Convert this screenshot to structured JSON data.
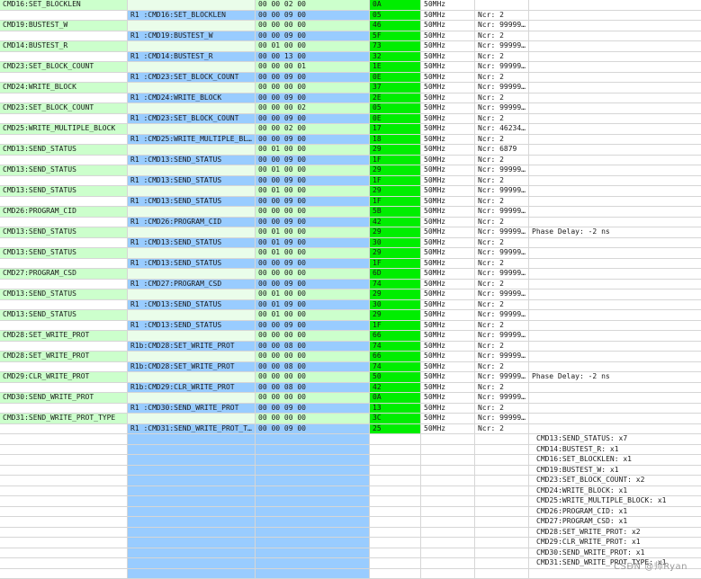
{
  "rows": [
    {
      "type": "cmd",
      "cmd": "CMD16:SET_BLOCKLEN",
      "resp": "",
      "arg": "00 00 02 00",
      "crc": "0A",
      "freq": "50MHz",
      "ncr": "",
      "note": ""
    },
    {
      "type": "resp",
      "cmd": "",
      "resp": "R1 :CMD16:SET_BLOCKLEN",
      "arg": "00 00 09 00",
      "crc": "05",
      "freq": "50MHz",
      "ncr": "Ncr: 2",
      "note": ""
    },
    {
      "type": "cmd",
      "cmd": "CMD19:BUSTEST_W",
      "resp": "",
      "arg": "00 00 00 00",
      "crc": "46",
      "freq": "50MHz",
      "ncr": "Ncr: 99999…",
      "note": ""
    },
    {
      "type": "resp",
      "cmd": "",
      "resp": "R1 :CMD19:BUSTEST_W",
      "arg": "00 00 09 00",
      "crc": "5F",
      "freq": "50MHz",
      "ncr": "Ncr: 2",
      "note": ""
    },
    {
      "type": "cmd",
      "cmd": "CMD14:BUSTEST_R",
      "resp": "",
      "arg": "00 01 00 00",
      "crc": "73",
      "freq": "50MHz",
      "ncr": "Ncr: 99999…",
      "note": ""
    },
    {
      "type": "resp",
      "cmd": "",
      "resp": "R1 :CMD14:BUSTEST_R",
      "arg": "00 00 13 00",
      "crc": "32",
      "freq": "50MHz",
      "ncr": "Ncr: 2",
      "note": ""
    },
    {
      "type": "cmd",
      "cmd": "CMD23:SET_BLOCK_COUNT",
      "resp": "",
      "arg": "00 00 00 01",
      "crc": "1E",
      "freq": "50MHz",
      "ncr": "Ncr: 99999…",
      "note": ""
    },
    {
      "type": "resp",
      "cmd": "",
      "resp": "R1 :CMD23:SET_BLOCK_COUNT",
      "arg": "00 00 09 00",
      "crc": "0E",
      "freq": "50MHz",
      "ncr": "Ncr: 2",
      "note": ""
    },
    {
      "type": "cmd",
      "cmd": "CMD24:WRITE_BLOCK",
      "resp": "",
      "arg": "00 00 00 00",
      "crc": "37",
      "freq": "50MHz",
      "ncr": "Ncr: 99999…",
      "note": ""
    },
    {
      "type": "resp",
      "cmd": "",
      "resp": "R1 :CMD24:WRITE_BLOCK",
      "arg": "00 00 09 00",
      "crc": "2E",
      "freq": "50MHz",
      "ncr": "Ncr: 2",
      "note": ""
    },
    {
      "type": "cmd",
      "cmd": "CMD23:SET_BLOCK_COUNT",
      "resp": "",
      "arg": "00 00 00 02",
      "crc": "05",
      "freq": "50MHz",
      "ncr": "Ncr: 99999…",
      "note": ""
    },
    {
      "type": "resp",
      "cmd": "",
      "resp": "R1 :CMD23:SET_BLOCK_COUNT",
      "arg": "00 00 09 00",
      "crc": "0E",
      "freq": "50MHz",
      "ncr": "Ncr: 2",
      "note": ""
    },
    {
      "type": "cmd",
      "cmd": "CMD25:WRITE_MULTIPLE_BLOCK",
      "resp": "",
      "arg": "00 00 02 00",
      "crc": "17",
      "freq": "50MHz",
      "ncr": "Ncr: 46234…",
      "note": ""
    },
    {
      "type": "resp",
      "cmd": "",
      "resp": "R1 :CMD25:WRITE_MULTIPLE_BL…",
      "arg": "00 00 09 00",
      "crc": "18",
      "freq": "50MHz",
      "ncr": "Ncr: 2",
      "note": ""
    },
    {
      "type": "cmd",
      "cmd": "CMD13:SEND_STATUS",
      "resp": "",
      "arg": "00 01 00 00",
      "crc": "29",
      "freq": "50MHz",
      "ncr": "Ncr: 6879",
      "note": ""
    },
    {
      "type": "resp",
      "cmd": "",
      "resp": "R1 :CMD13:SEND_STATUS",
      "arg": "00 00 09 00",
      "crc": "1F",
      "freq": "50MHz",
      "ncr": "Ncr: 2",
      "note": ""
    },
    {
      "type": "cmd",
      "cmd": "CMD13:SEND_STATUS",
      "resp": "",
      "arg": "00 01 00 00",
      "crc": "29",
      "freq": "50MHz",
      "ncr": "Ncr: 99999…",
      "note": ""
    },
    {
      "type": "resp",
      "cmd": "",
      "resp": "R1 :CMD13:SEND_STATUS",
      "arg": "00 00 09 00",
      "crc": "1F",
      "freq": "50MHz",
      "ncr": "Ncr: 2",
      "note": ""
    },
    {
      "type": "cmd",
      "cmd": "CMD13:SEND_STATUS",
      "resp": "",
      "arg": "00 01 00 00",
      "crc": "29",
      "freq": "50MHz",
      "ncr": "Ncr: 99999…",
      "note": ""
    },
    {
      "type": "resp",
      "cmd": "",
      "resp": "R1 :CMD13:SEND_STATUS",
      "arg": "00 00 09 00",
      "crc": "1F",
      "freq": "50MHz",
      "ncr": "Ncr: 2",
      "note": ""
    },
    {
      "type": "cmd",
      "cmd": "CMD26:PROGRAM_CID",
      "resp": "",
      "arg": "00 00 00 00",
      "crc": "5B",
      "freq": "50MHz",
      "ncr": "Ncr: 99999…",
      "note": ""
    },
    {
      "type": "resp",
      "cmd": "",
      "resp": "R1 :CMD26:PROGRAM_CID",
      "arg": "00 00 09 00",
      "crc": "42",
      "freq": "50MHz",
      "ncr": "Ncr: 2",
      "note": ""
    },
    {
      "type": "cmd",
      "cmd": "CMD13:SEND_STATUS",
      "resp": "",
      "arg": "00 01 00 00",
      "crc": "29",
      "freq": "50MHz",
      "ncr": "Ncr: 99999…",
      "note": "Phase Delay: -2 ns"
    },
    {
      "type": "resp",
      "cmd": "",
      "resp": "R1 :CMD13:SEND_STATUS",
      "arg": "00 01 09 00",
      "crc": "30",
      "freq": "50MHz",
      "ncr": "Ncr: 2",
      "note": ""
    },
    {
      "type": "cmd",
      "cmd": "CMD13:SEND_STATUS",
      "resp": "",
      "arg": "00 01 00 00",
      "crc": "29",
      "freq": "50MHz",
      "ncr": "Ncr: 99999…",
      "note": ""
    },
    {
      "type": "resp",
      "cmd": "",
      "resp": "R1 :CMD13:SEND_STATUS",
      "arg": "00 00 09 00",
      "crc": "1F",
      "freq": "50MHz",
      "ncr": "Ncr: 2",
      "note": ""
    },
    {
      "type": "cmd",
      "cmd": "CMD27:PROGRAM_CSD",
      "resp": "",
      "arg": "00 00 00 00",
      "crc": "6D",
      "freq": "50MHz",
      "ncr": "Ncr: 99999…",
      "note": ""
    },
    {
      "type": "resp",
      "cmd": "",
      "resp": "R1 :CMD27:PROGRAM_CSD",
      "arg": "00 00 09 00",
      "crc": "74",
      "freq": "50MHz",
      "ncr": "Ncr: 2",
      "note": ""
    },
    {
      "type": "cmd",
      "cmd": "CMD13:SEND_STATUS",
      "resp": "",
      "arg": "00 01 00 00",
      "crc": "29",
      "freq": "50MHz",
      "ncr": "Ncr: 99999…",
      "note": ""
    },
    {
      "type": "resp",
      "cmd": "",
      "resp": "R1 :CMD13:SEND_STATUS",
      "arg": "00 01 09 00",
      "crc": "30",
      "freq": "50MHz",
      "ncr": "Ncr: 2",
      "note": ""
    },
    {
      "type": "cmd",
      "cmd": "CMD13:SEND_STATUS",
      "resp": "",
      "arg": "00 01 00 00",
      "crc": "29",
      "freq": "50MHz",
      "ncr": "Ncr: 99999…",
      "note": ""
    },
    {
      "type": "resp",
      "cmd": "",
      "resp": "R1 :CMD13:SEND_STATUS",
      "arg": "00 00 09 00",
      "crc": "1F",
      "freq": "50MHz",
      "ncr": "Ncr: 2",
      "note": ""
    },
    {
      "type": "cmd",
      "cmd": "CMD28:SET_WRITE_PROT",
      "resp": "",
      "arg": "00 00 00 00",
      "crc": "66",
      "freq": "50MHz",
      "ncr": "Ncr: 99999…",
      "note": ""
    },
    {
      "type": "resp",
      "cmd": "",
      "resp": "R1b:CMD28:SET_WRITE_PROT",
      "arg": "00 00 08 00",
      "crc": "74",
      "freq": "50MHz",
      "ncr": "Ncr: 2",
      "note": ""
    },
    {
      "type": "cmd",
      "cmd": "CMD28:SET_WRITE_PROT",
      "resp": "",
      "arg": "00 00 00 00",
      "crc": "66",
      "freq": "50MHz",
      "ncr": "Ncr: 99999…",
      "note": ""
    },
    {
      "type": "resp",
      "cmd": "",
      "resp": "R1b:CMD28:SET_WRITE_PROT",
      "arg": "00 00 08 00",
      "crc": "74",
      "freq": "50MHz",
      "ncr": "Ncr: 2",
      "note": ""
    },
    {
      "type": "cmd",
      "cmd": "CMD29:CLR_WRITE_PROT",
      "resp": "",
      "arg": "00 00 00 00",
      "crc": "50",
      "freq": "50MHz",
      "ncr": "Ncr: 99999…",
      "note": "Phase Delay: -2 ns"
    },
    {
      "type": "resp",
      "cmd": "",
      "resp": "R1b:CMD29:CLR_WRITE_PROT",
      "arg": "00 00 08 00",
      "crc": "42",
      "freq": "50MHz",
      "ncr": "Ncr: 2",
      "note": ""
    },
    {
      "type": "cmd",
      "cmd": "CMD30:SEND_WRITE_PROT",
      "resp": "",
      "arg": "00 00 00 00",
      "crc": "0A",
      "freq": "50MHz",
      "ncr": "Ncr: 99999…",
      "note": ""
    },
    {
      "type": "resp",
      "cmd": "",
      "resp": "R1 :CMD30:SEND_WRITE_PROT",
      "arg": "00 00 09 00",
      "crc": "13",
      "freq": "50MHz",
      "ncr": "Ncr: 2",
      "note": ""
    },
    {
      "type": "cmd",
      "cmd": "CMD31:SEND_WRITE_PROT_TYPE",
      "resp": "",
      "arg": "00 00 00 00",
      "crc": "3C",
      "freq": "50MHz",
      "ncr": "Ncr: 99999…",
      "note": ""
    },
    {
      "type": "resp",
      "cmd": "",
      "resp": "R1 :CMD31:SEND_WRITE_PROT_T…",
      "arg": "00 00 09 00",
      "crc": "25",
      "freq": "50MHz",
      "ncr": "Ncr: 2",
      "note": ""
    }
  ],
  "summary": [
    "CMD13:SEND_STATUS: x7",
    "CMD14:BUSTEST_R: x1",
    "CMD16:SET_BLOCKLEN: x1",
    "CMD19:BUSTEST_W: x1",
    "CMD23:SET_BLOCK_COUNT: x2",
    "CMD24:WRITE_BLOCK: x1",
    "CMD25:WRITE_MULTIPLE_BLOCK: x1",
    "CMD26:PROGRAM_CID: x1",
    "CMD27:PROGRAM_CSD: x1",
    "CMD28:SET_WRITE_PROT: x2",
    "CMD29:CLR_WRITE_PROT: x1",
    "CMD30:SEND_WRITE_PROT: x1",
    "CMD31:SEND_WRITE_PROT_TYPE: x1"
  ],
  "watermark": "CSDN @师Ryan",
  "colors": {
    "cmd_row": "#ccffcc",
    "resp_row": "#99ccff",
    "crc_fill": "#00ee00"
  }
}
